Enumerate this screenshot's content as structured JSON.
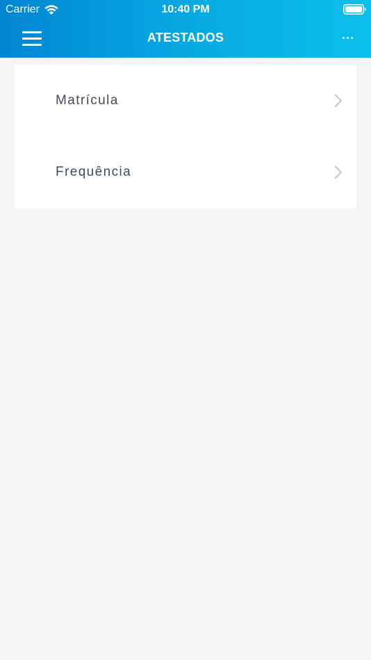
{
  "status_bar": {
    "carrier": "Carrier",
    "time": "10:40 PM",
    "wifi_icon": "wifi-icon",
    "battery_icon": "battery-icon"
  },
  "nav_bar": {
    "title": "ATESTADOS",
    "menu_icon": "hamburger-menu-icon",
    "more_icon": "more-dots-icon"
  },
  "list": {
    "items": [
      {
        "label": "Matrícula",
        "icon": "chevron-right-icon"
      },
      {
        "label": "Frequência",
        "icon": "chevron-right-icon"
      }
    ]
  },
  "colors": {
    "header_gradient_start": "#0186d2",
    "header_gradient_end": "#0ac0ea",
    "background": "#f5f5f5",
    "card": "#ffffff",
    "item_text": "#3e4c59",
    "chevron": "#c2c7cc"
  }
}
